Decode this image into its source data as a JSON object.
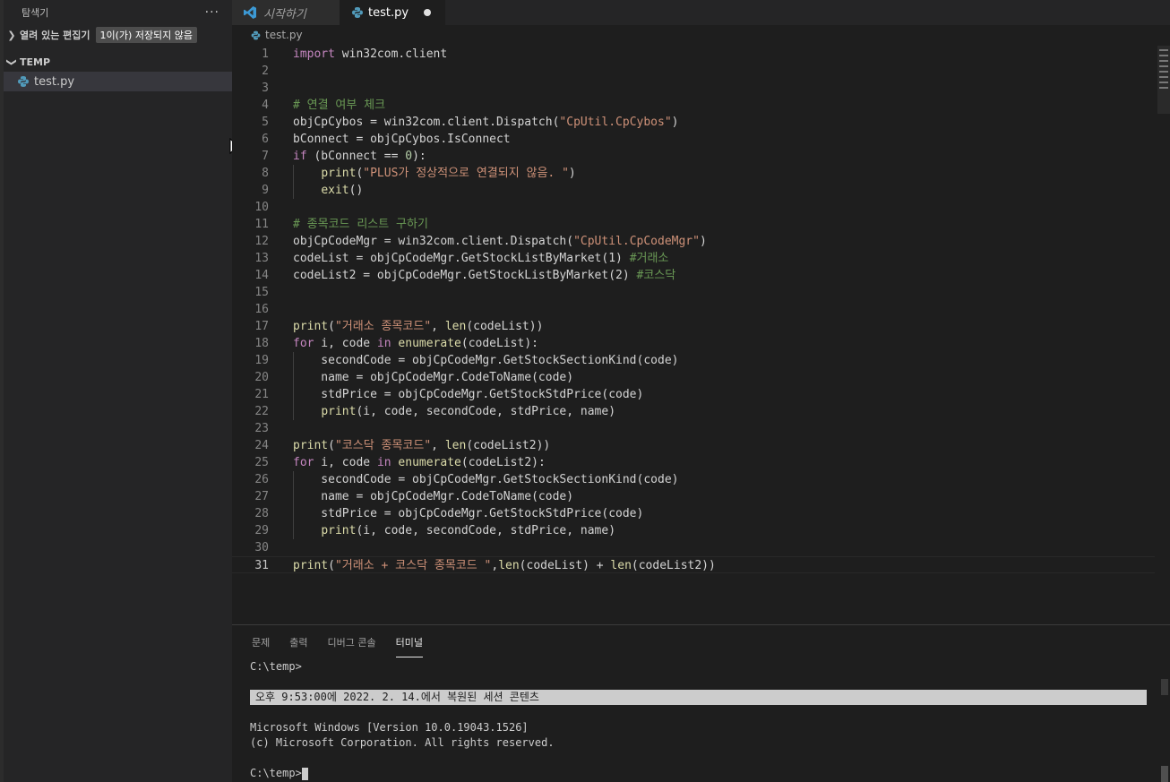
{
  "sidebar": {
    "title": "탐색기",
    "more": "···",
    "open_editors_label": "열려 있는 편집기",
    "unsaved_badge": "1이(가) 저장되지 않음",
    "folder_label": "TEMP",
    "files": [
      {
        "name": "test.py"
      }
    ]
  },
  "tabs": [
    {
      "label": "시작하기"
    },
    {
      "label": "test.py"
    }
  ],
  "breadcrumb": "test.py",
  "editor": {
    "current_line": 31,
    "lines": [
      [
        [
          "import",
          "kw"
        ],
        [
          " win32com.client",
          ""
        ]
      ],
      [],
      [],
      [
        [
          "# 연결 여부 체크",
          "cm"
        ]
      ],
      [
        [
          "objCpCybos = win32com.client.Dispatch(",
          ""
        ],
        [
          "\"CpUtil.CpCybos\"",
          "str"
        ],
        [
          ")",
          ""
        ]
      ],
      [
        [
          "bConnect = objCpCybos.IsConnect",
          ""
        ]
      ],
      [
        [
          "if",
          "kw"
        ],
        [
          " (bConnect == ",
          ""
        ],
        [
          "0",
          "num"
        ],
        [
          "):",
          ""
        ]
      ],
      [
        [
          "    ",
          ""
        ],
        [
          "print",
          "fn"
        ],
        [
          "(",
          ""
        ],
        [
          "\"PLUS가 정상적으로 연결되지 않음. \"",
          "str"
        ],
        [
          ")",
          ""
        ]
      ],
      [
        [
          "    ",
          ""
        ],
        [
          "exit",
          "fn"
        ],
        [
          "()",
          ""
        ]
      ],
      [],
      [
        [
          "# 종목코드 리스트 구하기",
          "cm"
        ]
      ],
      [
        [
          "objCpCodeMgr = win32com.client.Dispatch(",
          ""
        ],
        [
          "\"CpUtil.CpCodeMgr\"",
          "str"
        ],
        [
          ")",
          ""
        ]
      ],
      [
        [
          "codeList = objCpCodeMgr.GetStockListByMarket(1) ",
          ""
        ],
        [
          "#거래소",
          "cm"
        ]
      ],
      [
        [
          "codeList2 = objCpCodeMgr.GetStockListByMarket(2) ",
          ""
        ],
        [
          "#코스닥",
          "cm"
        ]
      ],
      [],
      [],
      [
        [
          "print",
          "fn"
        ],
        [
          "(",
          ""
        ],
        [
          "\"거래소 종목코드\"",
          "str"
        ],
        [
          ", ",
          ""
        ],
        [
          "len",
          "fn"
        ],
        [
          "(codeList))",
          ""
        ]
      ],
      [
        [
          "for",
          "kw"
        ],
        [
          " i, code ",
          ""
        ],
        [
          "in",
          "kw"
        ],
        [
          " ",
          ""
        ],
        [
          "enumerate",
          "fn"
        ],
        [
          "(codeList):",
          ""
        ]
      ],
      [
        [
          "    secondCode = objCpCodeMgr.GetStockSectionKind(code)",
          ""
        ]
      ],
      [
        [
          "    name = objCpCodeMgr.CodeToName(code)",
          ""
        ]
      ],
      [
        [
          "    stdPrice = objCpCodeMgr.GetStockStdPrice(code)",
          ""
        ]
      ],
      [
        [
          "    ",
          ""
        ],
        [
          "print",
          "fn"
        ],
        [
          "(i, code, secondCode, stdPrice, name)",
          ""
        ]
      ],
      [],
      [
        [
          "print",
          "fn"
        ],
        [
          "(",
          ""
        ],
        [
          "\"코스닥 종목코드\"",
          "str"
        ],
        [
          ", ",
          ""
        ],
        [
          "len",
          "fn"
        ],
        [
          "(codeList2))",
          ""
        ]
      ],
      [
        [
          "for",
          "kw"
        ],
        [
          " i, code ",
          ""
        ],
        [
          "in",
          "kw"
        ],
        [
          " ",
          ""
        ],
        [
          "enumerate",
          "fn"
        ],
        [
          "(codeList2):",
          ""
        ]
      ],
      [
        [
          "    secondCode = objCpCodeMgr.GetStockSectionKind(code)",
          ""
        ]
      ],
      [
        [
          "    name = objCpCodeMgr.CodeToName(code)",
          ""
        ]
      ],
      [
        [
          "    stdPrice = objCpCodeMgr.GetStockStdPrice(code)",
          ""
        ]
      ],
      [
        [
          "    ",
          ""
        ],
        [
          "print",
          "fn"
        ],
        [
          "(i, code, secondCode, stdPrice, name)",
          ""
        ]
      ],
      [],
      [
        [
          "print",
          "fn"
        ],
        [
          "(",
          ""
        ],
        [
          "\"거래소 + 코스닥 종목코드 \"",
          "str"
        ],
        [
          ",",
          ""
        ],
        [
          "len",
          "fn"
        ],
        [
          "(codeList) + ",
          ""
        ],
        [
          "len",
          "fn"
        ],
        [
          "(codeList2))",
          ""
        ]
      ]
    ]
  },
  "panel": {
    "tabs": [
      "문제",
      "출력",
      "디버그 콘솔",
      "터미널"
    ],
    "active_tab": "터미널"
  },
  "terminal": {
    "prompt1": "C:\\temp>",
    "restored": "오후 9:53:00에 2022. 2. 14.에서 복원된 세션 콘텐츠",
    "win_version": "Microsoft Windows [Version 10.0.19043.1526]",
    "copyright": "(c) Microsoft Corporation. All rights reserved.",
    "prompt2": "C:\\temp>"
  }
}
